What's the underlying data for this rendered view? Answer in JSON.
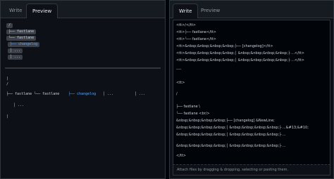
{
  "left": {
    "tabs": {
      "write": "Write",
      "preview": "Preview"
    },
    "chips": [
      "/",
      "├── fastlane",
      "└── fastlane",
      "├── changelog",
      "│ ...",
      "│ ..."
    ],
    "body": {
      "line1": "|",
      "line2": "/",
      "tree_a": "├── fastlane └── fastlane",
      "tree_b": "├── changelog",
      "tree_c": "│ ...",
      "tree_d": "│ ...",
      "line_last_a": "│ ...",
      "line_last_b": "|"
    }
  },
  "right": {
    "tabs": {
      "write": "Write",
      "preview": "Preview"
    },
    "lines": [
      "<tt>/</tt>",
      "<tt>├── fastlane</tt>",
      "<tt>└── fastlane</tt>",
      "<tt>&nbsp;&nbsp;&nbsp;&nbsp;├── [changelog]</tt>",
      "<tt>&nbsp;&nbsp;&nbsp;&nbsp;│ &nbsp;&nbsp;&nbsp;&nbsp;├ ...</tt>",
      "<tt>&nbsp;&nbsp;&nbsp;&nbsp;│ &nbsp;&nbsp;&nbsp;&nbsp;├ ...</tt>",
      "----",
      "<tt>",
      "/",
      "├── fastlane \\",
      "└── fastlane <br/>",
      "&nbsp;&nbsp;&nbsp;&nbsp;├── [changelog] &NewLine;",
      "&nbsp;&nbsp;&nbsp;&nbsp;│ &nbsp;&nbsp;&nbsp;&nbsp;├ ...&#13;&#10;",
      "&nbsp;&nbsp;&nbsp;&nbsp;│ &nbsp;&nbsp;&nbsp;&nbsp;├ ...",
      "&nbsp;&nbsp;&nbsp;&nbsp;│ &nbsp;&nbsp;&nbsp;&nbsp;├ ...",
      "</tt>"
    ],
    "attach_hint": "Attach files by dragging & dropping, selecting or pasting them."
  }
}
